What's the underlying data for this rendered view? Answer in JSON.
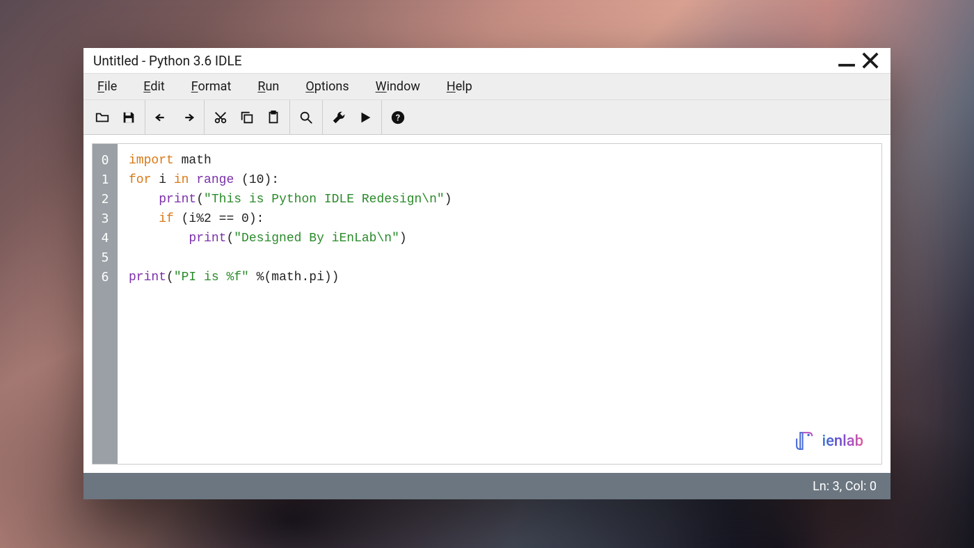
{
  "title": "Untitled - Python 3.6 IDLE",
  "menus": {
    "file": {
      "u": "F",
      "rest": "ile"
    },
    "edit": {
      "u": "E",
      "rest": "dit"
    },
    "format": {
      "u": "F",
      "rest": "ormat"
    },
    "run": {
      "u": "R",
      "rest": "un"
    },
    "options": {
      "u": "O",
      "rest": "ptions"
    },
    "window": {
      "u": "W",
      "rest": "indow"
    },
    "help": {
      "u": "H",
      "rest": "elp"
    }
  },
  "gutter": [
    "0",
    "1",
    "2",
    "3",
    "4",
    "5",
    "6"
  ],
  "code": {
    "l0": {
      "kw": "import",
      "rest": " math"
    },
    "l1": {
      "kw_for": "for",
      "i": " i ",
      "kw_in": "in",
      "sp": " ",
      "fn": "range",
      "rest": " (10):"
    },
    "l2": {
      "indent": "    ",
      "fn": "print",
      "open": "(",
      "str": "\"This is Python IDLE Redesign\\n\"",
      "close": ")"
    },
    "l3": {
      "indent": "    ",
      "kw_if": "if",
      "rest": " (i%2 == 0):"
    },
    "l4": {
      "indent": "        ",
      "fn": "print",
      "open": "(",
      "str": "\"Designed By iEnLab\\n\"",
      "close": ")"
    },
    "l5": {
      "blank": ""
    },
    "l6": {
      "fn": "print",
      "open": "(",
      "str": "\"PI is %f\"",
      "rest": " %(math.pi))"
    }
  },
  "logo_text": "ienlab",
  "status": "Ln: 3, Col: 0"
}
